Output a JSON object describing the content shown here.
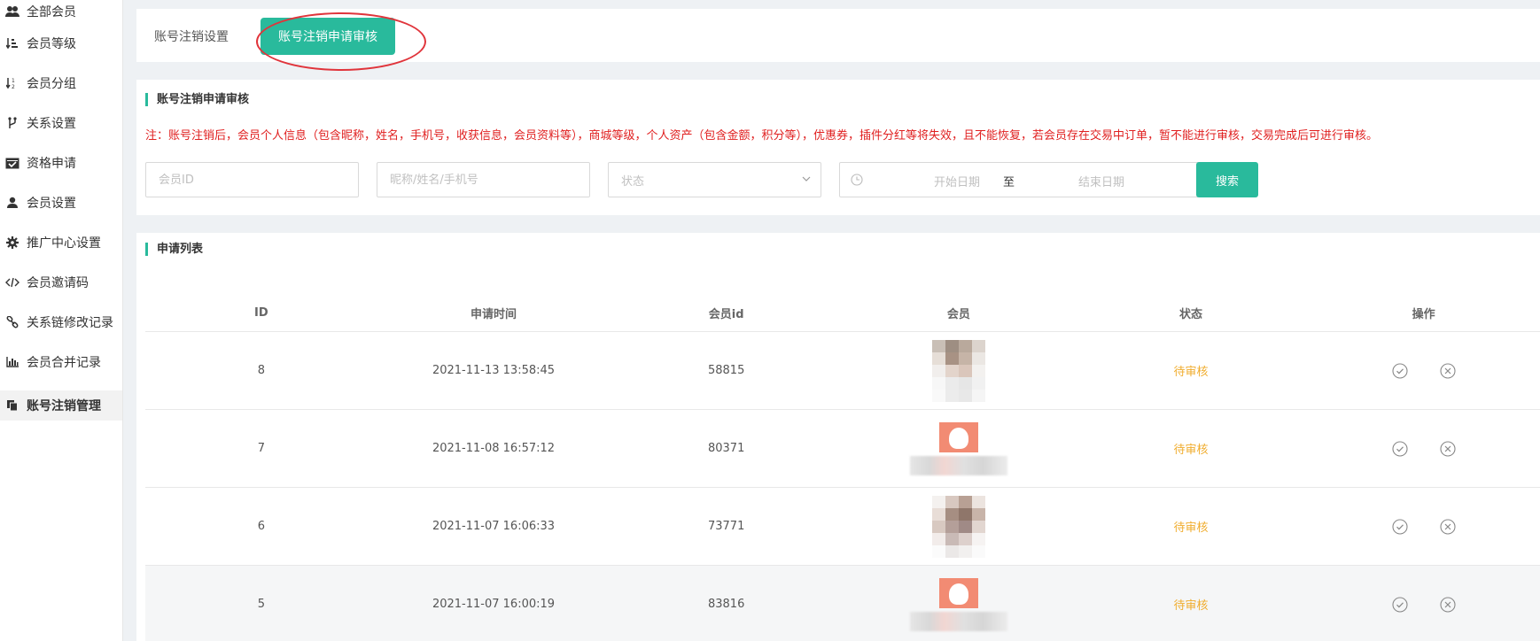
{
  "sidebar": {
    "items": [
      {
        "label": "全部会员",
        "icon": "users-icon"
      },
      {
        "label": "会员等级",
        "icon": "sort-amount-icon"
      },
      {
        "label": "会员分组",
        "icon": "sort-numeric-icon"
      },
      {
        "label": "关系设置",
        "icon": "code-fork-icon"
      },
      {
        "label": "资格申请",
        "icon": "calendar-check-icon"
      },
      {
        "label": "会员设置",
        "icon": "user-icon"
      },
      {
        "label": "推广中心设置",
        "icon": "gear-icon"
      },
      {
        "label": "会员邀请码",
        "icon": "code-icon"
      },
      {
        "label": "关系链修改记录",
        "icon": "link-icon"
      },
      {
        "label": "会员合并记录",
        "icon": "bar-chart-icon"
      },
      {
        "label": "账号注销管理",
        "icon": "copy-icon"
      }
    ],
    "active_index": 10
  },
  "tabs": {
    "settings_label": "账号注销设置",
    "review_label": "账号注销申请审核"
  },
  "filter": {
    "section_title": "账号注销申请审核",
    "note": "注：账号注销后，会员个人信息（包含昵称，姓名，手机号，收获信息，会员资料等），商城等级，个人资产（包含金额，积分等），优惠券，插件分红等将失效，且不能恢复，若会员存在交易中订单，暂不能进行审核，交易完成后可进行审核。",
    "member_id_placeholder": "会员ID",
    "name_placeholder": "昵称/姓名/手机号",
    "status_placeholder": "状态",
    "start_date_placeholder": "开始日期",
    "range_separator": "至",
    "end_date_placeholder": "结束日期",
    "search_label": "搜索"
  },
  "list": {
    "section_title": "申请列表",
    "columns": [
      "ID",
      "申请时间",
      "会员id",
      "会员",
      "状态",
      "操作"
    ],
    "rows": [
      {
        "id": "8",
        "time": "2021-11-13 13:58:45",
        "member_id": "58815",
        "status": "待审核"
      },
      {
        "id": "7",
        "time": "2021-11-08 16:57:12",
        "member_id": "80371",
        "status": "待审核"
      },
      {
        "id": "6",
        "time": "2021-11-07 16:06:33",
        "member_id": "73771",
        "status": "待审核"
      },
      {
        "id": "5",
        "time": "2021-11-07 16:00:19",
        "member_id": "83816",
        "status": "待审核"
      }
    ]
  },
  "colors": {
    "accent": "#29ba9c",
    "note_red": "#e02020",
    "pending": "#f0ad2f",
    "annotation_circle": "#e0343b"
  }
}
